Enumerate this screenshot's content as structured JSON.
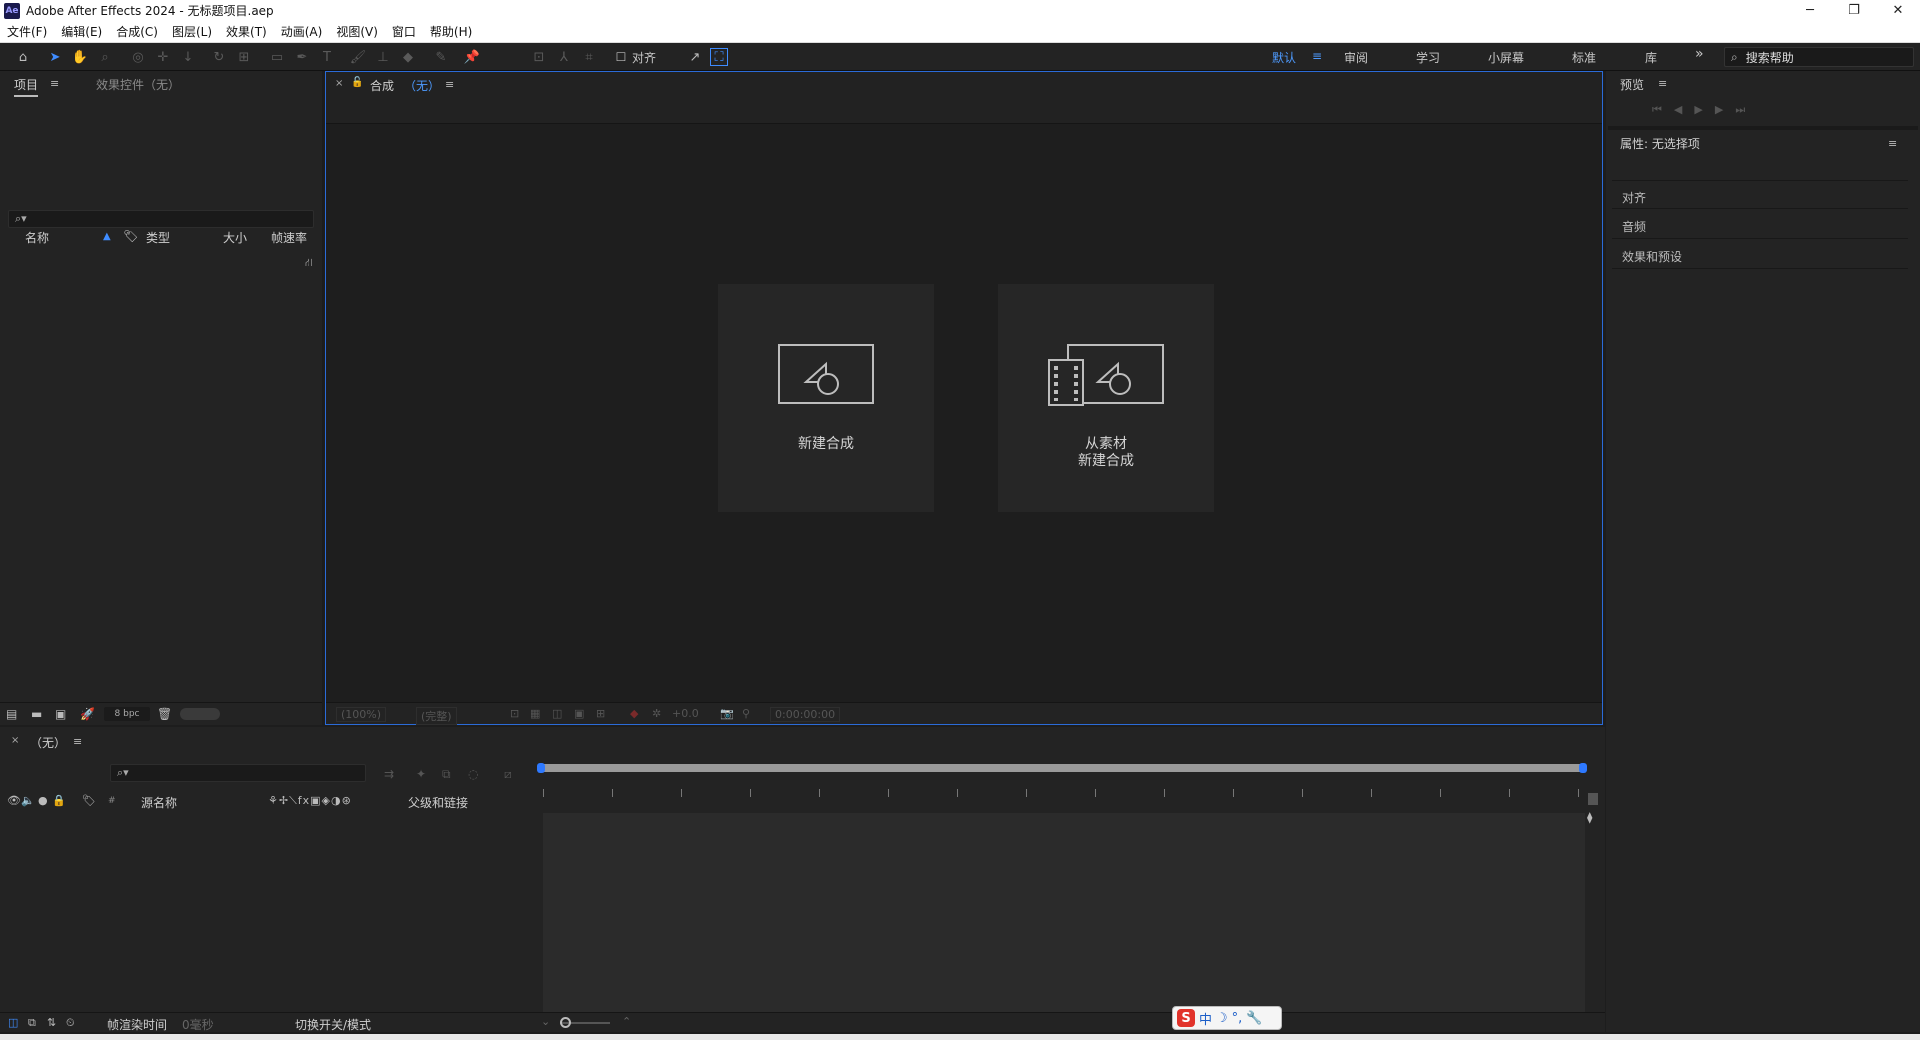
{
  "window": {
    "logo": "Ae",
    "title": "Adobe After Effects 2024 - 无标题项目.aep",
    "controls": [
      "─",
      "❐",
      "✕"
    ]
  },
  "menu": [
    "文件(F)",
    "编辑(E)",
    "合成(C)",
    "图层(L)",
    "效果(T)",
    "动画(A)",
    "视图(V)",
    "窗口",
    "帮助(H)"
  ],
  "toolbar": {
    "snap_label": "对齐",
    "workspaces": [
      "默认",
      "审阅",
      "学习",
      "小屏幕",
      "标准",
      "库"
    ],
    "active_workspace": "默认",
    "more": "»",
    "help_search_placeholder": "搜索帮助"
  },
  "project_panel": {
    "tabs": [
      "项目",
      "效果控件（无）"
    ],
    "columns": [
      "名称",
      "类型",
      "大小",
      "帧速率"
    ],
    "bpc": "8 bpc"
  },
  "comp_panel": {
    "tab_label": "合成",
    "tab_value": "（无）",
    "cards": [
      {
        "label": "新建合成"
      },
      {
        "label_line1": "从素材",
        "label_line2": "新建合成"
      }
    ],
    "footer": {
      "zoom": "(100%)",
      "resolution": "(完整)",
      "exposure": "+0.0",
      "timecode": "0:00:00:00"
    }
  },
  "right_panel": {
    "preview_title": "预览",
    "properties_title": "属性: 无选择项",
    "sections": [
      "对齐",
      "音频",
      "效果和预设"
    ]
  },
  "timeline": {
    "tab_label": "（无）",
    "columns": [
      "源名称",
      "父级和链接"
    ],
    "render_time_label": "帧渲染时间",
    "render_time_value": "0毫秒",
    "toggle_label": "切换开关/模式"
  },
  "ime": {
    "logo": "S",
    "items": [
      "中",
      "☽",
      "°,",
      "🔧"
    ]
  },
  "colors": {
    "accent": "#2e79ff",
    "panel": "#232323",
    "background": "#1d1d1d"
  }
}
